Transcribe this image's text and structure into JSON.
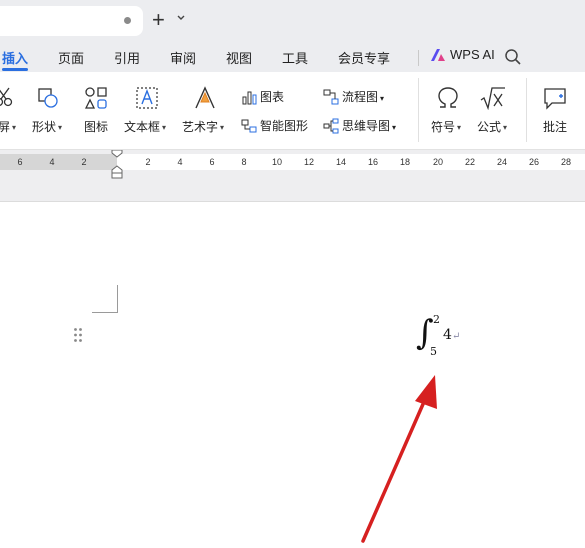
{
  "titlebar": {
    "new_tab_symbol": "+"
  },
  "menu": {
    "tabs": [
      {
        "label": "插入",
        "active": true
      },
      {
        "label": "页面"
      },
      {
        "label": "引用"
      },
      {
        "label": "审阅"
      },
      {
        "label": "视图"
      },
      {
        "label": "工具"
      },
      {
        "label": "会员专享"
      }
    ],
    "wps_ai_label": "WPS AI",
    "accent_color": "#2b6fe0"
  },
  "ribbon": {
    "screenshot_label": "屏",
    "shape_label": "形状",
    "icon_label": "图标",
    "textbox_label": "文本框",
    "wordart_label": "艺术字",
    "chart_label": "图表",
    "smartart_label": "智能图形",
    "flowchart_label": "流程图",
    "mindmap_label": "思维导图",
    "symbol_label": "符号",
    "formula_label": "公式",
    "comment_label": "批注"
  },
  "ruler": {
    "ticks": [
      "6",
      "4",
      "2",
      "2",
      "4",
      "6",
      "8",
      "10",
      "12",
      "14",
      "16",
      "18",
      "20",
      "22",
      "24",
      "26",
      "28"
    ]
  },
  "equation": {
    "upper_limit": "2",
    "lower_limit": "5",
    "integrand": "4",
    "paragraph_mark": "↵"
  },
  "annotation": {
    "arrow_color": "#d62020"
  }
}
